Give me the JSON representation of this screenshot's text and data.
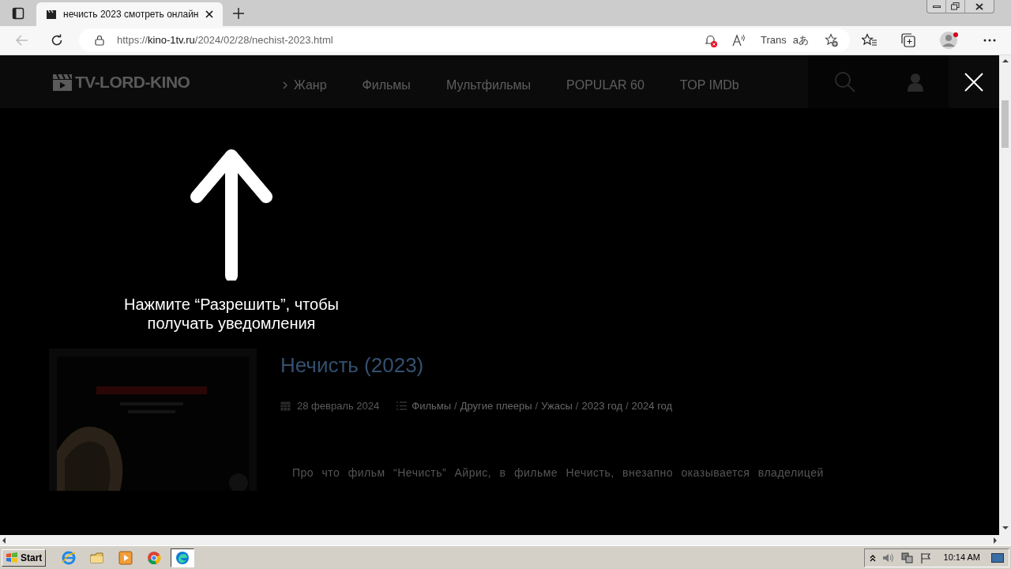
{
  "browser": {
    "tab_title": "нечисть 2023 смотреть онлайн",
    "url": {
      "scheme": "https://",
      "host": "kino-1tv.ru",
      "path": "/2024/02/28/nechist-2023.html"
    },
    "translate_label": "Trans",
    "translate_glyph": "aあ"
  },
  "site": {
    "logo": "TV-LORD-KINO",
    "nav": [
      {
        "label": "Жанр",
        "kind": "dropdown"
      },
      {
        "label": "Фильмы",
        "kind": "link"
      },
      {
        "label": "Мультфильмы",
        "kind": "link"
      },
      {
        "label": "POPULAR 60",
        "kind": "link"
      },
      {
        "label": "TOP IMDb",
        "kind": "link"
      }
    ]
  },
  "prompt": {
    "text": "Нажмите “Разрешить”, чтобы получать уведомления"
  },
  "movie": {
    "title": "Нечисть (2023)",
    "date": "28 февраль 2024",
    "categories": [
      "Фильмы",
      "Другие плееры",
      "Ужасы",
      "2023 год",
      "2024 год"
    ],
    "category_separator": "/",
    "description": "Про что фильм “Нечисть” Айрис, в фильме Нечисть, внезапно оказывается владелицей"
  },
  "taskbar": {
    "start": "Start",
    "apps": [
      {
        "kind": "ie",
        "selected": false
      },
      {
        "kind": "folder",
        "selected": false
      },
      {
        "kind": "media",
        "selected": false
      },
      {
        "kind": "chrome",
        "selected": false
      },
      {
        "kind": "edge",
        "selected": true
      }
    ],
    "clock": "10:14 AM"
  }
}
